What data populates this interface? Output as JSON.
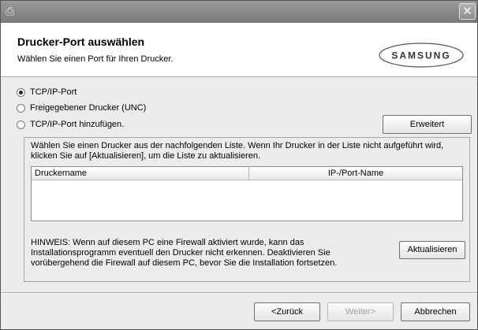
{
  "window": {
    "close_glyph": "✕",
    "icon_glyph": "⎙"
  },
  "header": {
    "title": "Drucker-Port auswählen",
    "subtitle": "Wählen Sie einen Port für Ihren Drucker.",
    "logo_text": "SAMSUNG"
  },
  "port_options": [
    {
      "label": "TCP/IP-Port",
      "selected": true
    },
    {
      "label": "Freigegebener Drucker (UNC)",
      "selected": false
    },
    {
      "label": "TCP/IP-Port hinzufügen.",
      "selected": false
    }
  ],
  "advanced_button": "Erweitert",
  "printer_list": {
    "description": "Wählen Sie einen Drucker aus der nachfolgenden Liste. Wenn Ihr Drucker in der Liste nicht aufgeführt wird, klicken Sie auf [Aktualisieren], um die Liste zu aktualisieren.",
    "columns": [
      "Druckername",
      "IP-/Port-Name"
    ],
    "rows": []
  },
  "hint": "HINWEIS: Wenn auf diesem PC eine Firewall aktiviert wurde, kann das Installationsprogramm eventuell den Drucker nicht erkennen. Deaktivieren Sie vorübergehend die Firewall auf diesem PC, bevor Sie die Installation fortsetzen.",
  "refresh_button": "Aktualisieren",
  "footer": {
    "back": "<Zurück",
    "next": "Weiter>",
    "cancel": "Abbrechen"
  }
}
